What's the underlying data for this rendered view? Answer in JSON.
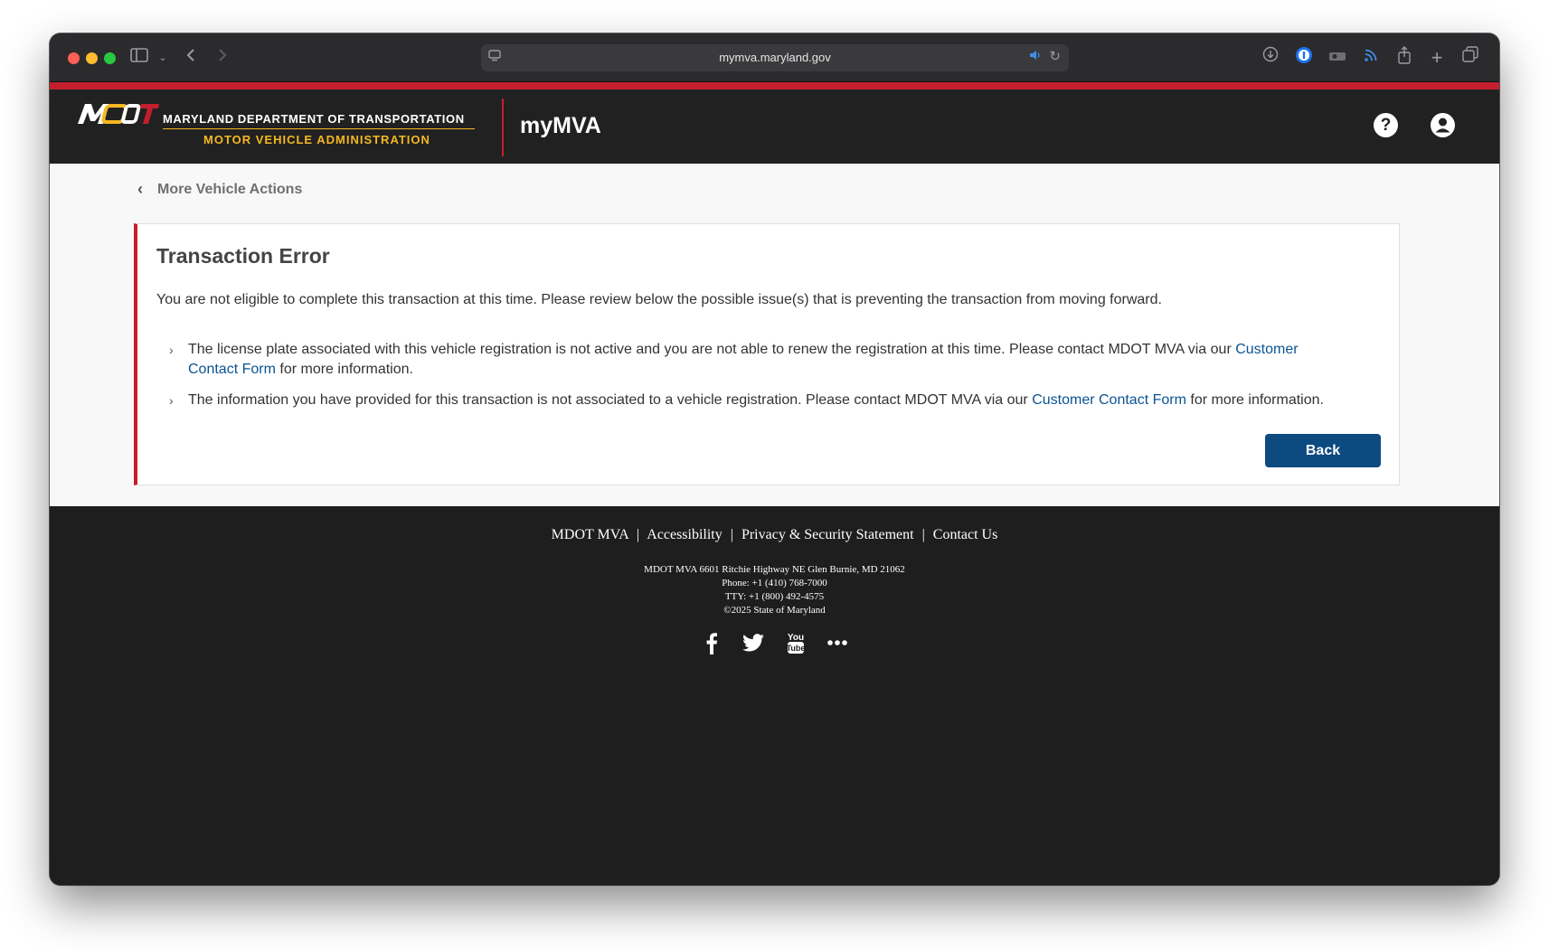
{
  "browser": {
    "url": "mymva.maryland.gov"
  },
  "header": {
    "logo_mark": "MDOT",
    "logo_department": "MARYLAND DEPARTMENT OF TRANSPORTATION",
    "logo_administration": "MOTOR VEHICLE ADMINISTRATION",
    "app_title": "myMVA",
    "help_icon": "help-circle-icon",
    "account_icon": "user-circle-icon"
  },
  "breadcrumb": {
    "label": "More Vehicle Actions"
  },
  "error": {
    "title": "Transaction Error",
    "description": "You are not eligible to complete this transaction at this time. Please review below the possible issue(s) that is preventing the transaction from moving forward.",
    "issues": [
      {
        "before": "The license plate associated with this vehicle registration is not active and you are not able to renew the registration at this time. Please contact MDOT MVA via our ",
        "link": "Customer Contact Form",
        "after": " for more information."
      },
      {
        "before": "The information you have provided for this transaction is not associated to a vehicle registration. Please contact MDOT MVA via our ",
        "link": "Customer Contact Form",
        "after": " for more information."
      }
    ],
    "back_label": "Back"
  },
  "footer": {
    "links": [
      "MDOT MVA",
      "Accessibility",
      "Privacy & Security Statement",
      "Contact Us"
    ],
    "separator": "|",
    "address": "MDOT MVA 6601 Ritchie Highway NE Glen Burnie, MD 21062",
    "phone": "Phone: +1 (410) 768-7000",
    "tty": "TTY: +1 (800) 492-4575",
    "copyright": "©2025 State of Maryland",
    "socials": [
      "facebook-icon",
      "twitter-icon",
      "youtube-icon",
      "more-icon"
    ]
  },
  "colors": {
    "brand_red": "#c41e2e",
    "brand_gold": "#f5b820",
    "button_blue": "#0d4a80",
    "link_blue": "#0b5394"
  }
}
